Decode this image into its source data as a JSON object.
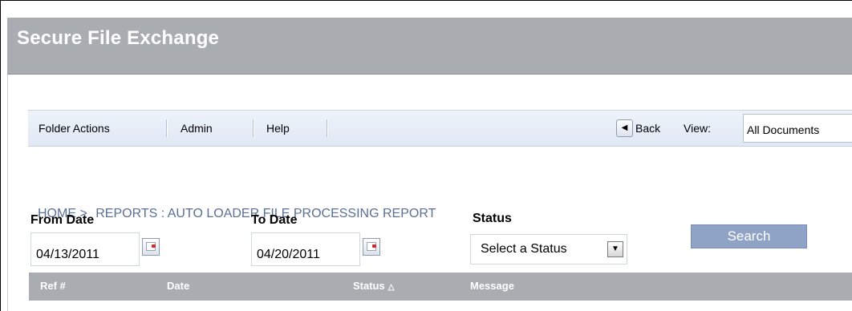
{
  "app": {
    "title": "Secure File Exchange"
  },
  "toolbar": {
    "menu": [
      "Folder Actions",
      "Admin",
      "Help"
    ],
    "back_label": "Back",
    "view_label": "View:",
    "view_value": "All Documents"
  },
  "breadcrumb": {
    "home": "HOME",
    "separator": ">",
    "current": "REPORTS : AUTO LOADER FILE PROCESSING REPORT"
  },
  "filters": {
    "from_label": "From Date",
    "from_value": "04/13/2011",
    "to_label": "To Date",
    "to_value": "04/20/2011",
    "status_label": "Status",
    "status_value": "Select a Status",
    "search_label": "Search"
  },
  "table": {
    "columns": [
      "Ref #",
      "Date",
      "Status",
      "Message"
    ]
  },
  "colors": {
    "title_bar": "#a9adb2",
    "toolbar_bg": "#e4ebf6",
    "breadcrumb_text": "#5a6f95",
    "search_button": "#8fa3c7",
    "table_header": "#a9adb2"
  },
  "icons": {
    "back": "back-arrow-icon",
    "calendar": "calendar-icon",
    "dropdown": "dropdown-arrow-icon",
    "sort": "sort-ascending-icon"
  }
}
